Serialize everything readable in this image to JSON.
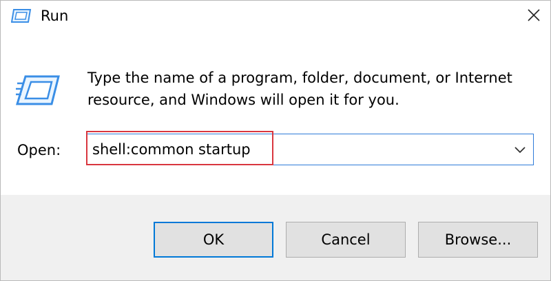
{
  "window": {
    "title": "Run",
    "title_icon": "run-icon",
    "close_icon": "close-icon"
  },
  "content": {
    "description": "Type the name of a program, folder, document, or Internet resource, and Windows will open it for you.",
    "main_icon": "run-icon"
  },
  "open": {
    "label": "Open:",
    "value": "shell:common startup",
    "dropdown_icon": "chevron-down-icon"
  },
  "buttons": {
    "ok": "OK",
    "cancel": "Cancel",
    "browse": "Browse..."
  },
  "colors": {
    "accent": "#0078d7",
    "highlight": "#d9363e",
    "footer_bg": "#f0f0f0"
  }
}
